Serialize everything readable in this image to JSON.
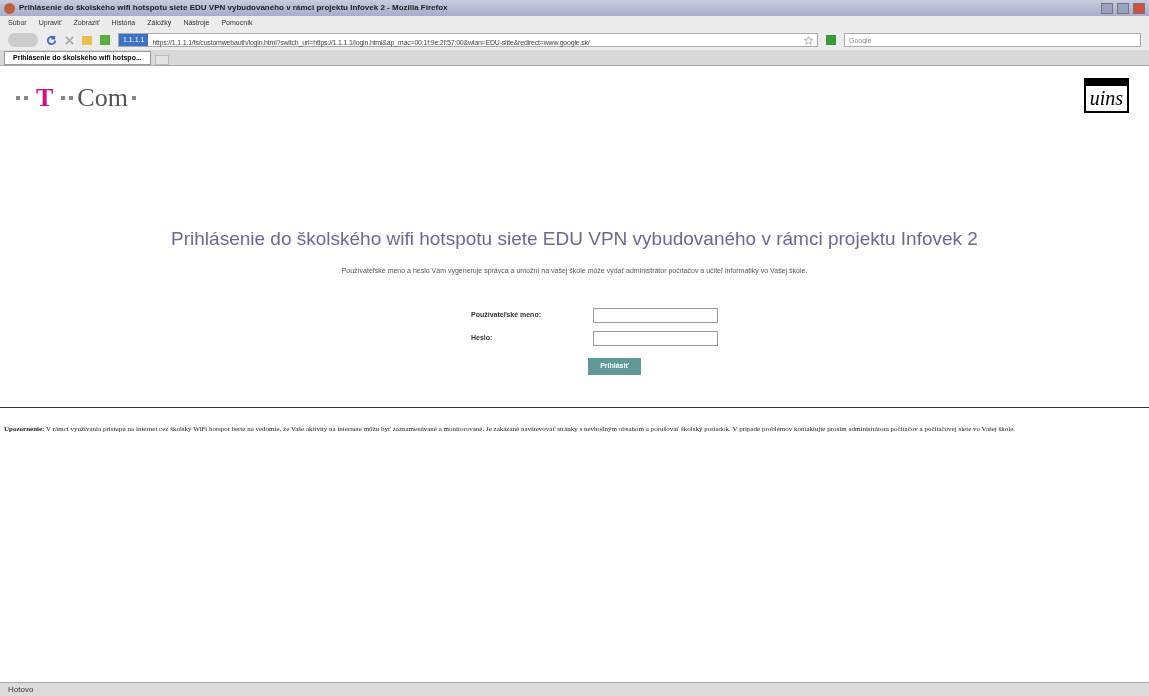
{
  "window": {
    "title": "Prihlásenie do školského wifi hotspotu siete EDU VPN vybudovaného v rámci projektu Infovek 2 - Mozilla Firefox"
  },
  "menu": [
    "Súbor",
    "Upraviť",
    "Zobraziť",
    "História",
    "Záložky",
    "Nástroje",
    "Pomocník"
  ],
  "navigation": {
    "site_identity": "1.1.1.1",
    "url": "https://1.1.1.1/fs/customwebauth/login.html?switch_url=https://1.1.1.1/login.html&ap_mac=00:1f:9e:2f:57:00&wlan=EDU-sitte&redirect=www.google.sk/",
    "search": {
      "placeholder": "Google"
    }
  },
  "tabs": [
    {
      "label": "Prihlásenie do školského wifi hotspo...",
      "selected": true
    }
  ],
  "page": {
    "logo_left": {
      "mark": "T",
      "name": "Com"
    },
    "logo_right": "uins",
    "heading": "Prihlásenie do školského wifi hotspotu siete EDU VPN vybudovaného v rámci projektu Infovek 2",
    "description": "Používateľské meno a heslo Vám vygeneruje správca a umožní na vašej škole môže vydať administrátor počítačov a učiteľ informatiky vo Vašej škole.",
    "form": {
      "fields": [
        {
          "label": "Používateľské meno:"
        },
        {
          "label": "Heslo:"
        }
      ],
      "submit": "Prihlásiť"
    },
    "notice": "**Upozornenie:** V rámci využívania prístupu na internet cez školský WiFi hotspot berte na vedomie, že Vaše aktivity na internete môžu byť zaznamenávané a monitorované. Je zakázané navštevovať stránky s nevhodným obsahom a porušovať školský poriadok. V prípade problémov kontaktujte prosím administrátora počítačov a počítačovej siete vo Vašej škole."
  },
  "status_bar": "Hotovo"
}
